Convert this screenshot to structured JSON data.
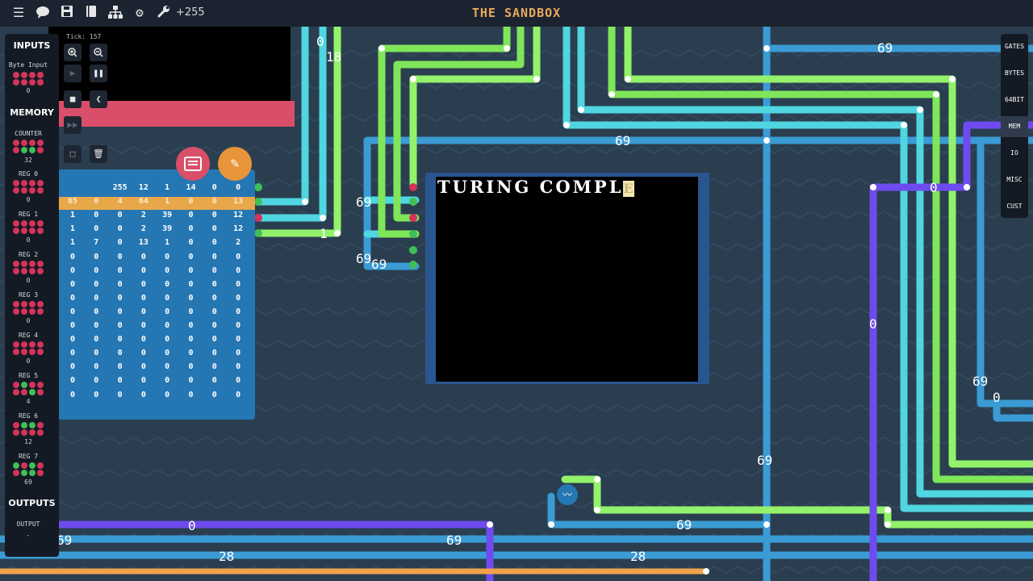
{
  "app": {
    "title": "THE SANDBOX",
    "points": "+255"
  },
  "toolbar": {
    "icons": [
      "menu-icon",
      "chat-icon",
      "save-icon",
      "notebook-icon",
      "hierarchy-icon",
      "gear-icon",
      "wrench-icon"
    ]
  },
  "simulation": {
    "tick_label": "Tick: 157"
  },
  "left_panel": {
    "inputs_title": "INPUTS",
    "byte_input_label": "Byte Input",
    "byte_input_value": "0",
    "memory_title": "MEMORY",
    "counter_label": "COUNTER",
    "counter_value": "32",
    "registers": [
      {
        "label": "REG 0",
        "value": "0"
      },
      {
        "label": "REG 1",
        "value": "0"
      },
      {
        "label": "REG 2",
        "value": "0"
      },
      {
        "label": "REG 3",
        "value": "0"
      },
      {
        "label": "REG 4",
        "value": "0"
      },
      {
        "label": "REG 5",
        "value": "4"
      },
      {
        "label": "REG 6",
        "value": "12"
      },
      {
        "label": "REG 7",
        "value": "69"
      }
    ],
    "outputs_title": "OUTPUTS",
    "output_label": "OUTPUT",
    "output_value": "-"
  },
  "right_panel": {
    "items": [
      "GATES",
      "BYTES",
      "64BIT",
      "MEM",
      "IO",
      "MISC",
      "CUST"
    ],
    "active": "MEM"
  },
  "ram_table": {
    "rows": [
      [
        "",
        "",
        "255",
        "12",
        "1",
        "14",
        "0",
        "0"
      ],
      [
        "65",
        "0",
        "4",
        "64",
        "1",
        "0",
        "0",
        "13"
      ],
      [
        "1",
        "0",
        "0",
        "2",
        "39",
        "0",
        "0",
        "12"
      ],
      [
        "1",
        "0",
        "0",
        "2",
        "39",
        "0",
        "0",
        "12"
      ],
      [
        "1",
        "7",
        "0",
        "13",
        "1",
        "0",
        "0",
        "2"
      ],
      [
        "0",
        "0",
        "0",
        "0",
        "0",
        "0",
        "0",
        "0"
      ],
      [
        "0",
        "0",
        "0",
        "0",
        "0",
        "0",
        "0",
        "0"
      ],
      [
        "0",
        "0",
        "0",
        "0",
        "0",
        "0",
        "0",
        "0"
      ],
      [
        "0",
        "0",
        "0",
        "0",
        "0",
        "0",
        "0",
        "0"
      ],
      [
        "0",
        "0",
        "0",
        "0",
        "0",
        "0",
        "0",
        "0"
      ],
      [
        "0",
        "0",
        "0",
        "0",
        "0",
        "0",
        "0",
        "0"
      ],
      [
        "0",
        "0",
        "0",
        "0",
        "0",
        "0",
        "0",
        "0"
      ],
      [
        "0",
        "0",
        "0",
        "0",
        "0",
        "0",
        "0",
        "0"
      ],
      [
        "0",
        "0",
        "0",
        "0",
        "0",
        "0",
        "0",
        "0"
      ],
      [
        "0",
        "0",
        "0",
        "0",
        "0",
        "0",
        "0",
        "0"
      ],
      [
        "0",
        "0",
        "0",
        "0",
        "0",
        "0",
        "0",
        "0"
      ]
    ],
    "highlight_row": 1
  },
  "console": {
    "text": "TURING COMPL",
    "cursor_char": "E"
  },
  "wire_labels": [
    "69",
    "69",
    "69",
    "69",
    "69",
    "69",
    "69",
    "0",
    "0",
    "0",
    "0",
    "0",
    "28",
    "28",
    "18",
    "1",
    "69",
    "69",
    "69"
  ],
  "colors": {
    "wire_cyan": "#4fd6e0",
    "wire_blue": "#3b9bd4",
    "wire_green": "#7fe65a",
    "wire_bright_green": "#93f26a",
    "wire_purple": "#6f4bef",
    "wire_orange": "#f0a24a",
    "title_orange": "#e8a85a",
    "red_dot": "#d3345a",
    "green_dot": "#3fbf57"
  }
}
